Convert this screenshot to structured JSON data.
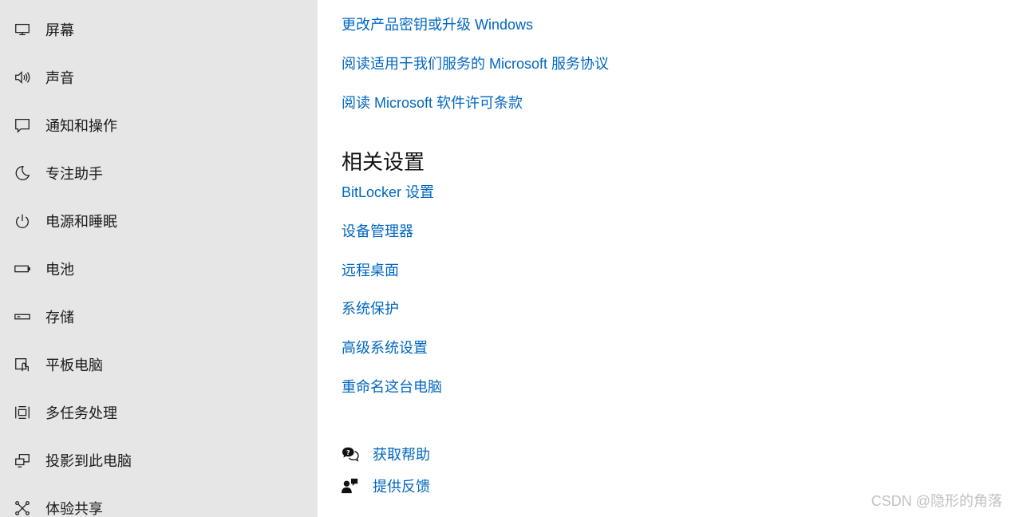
{
  "sidebar": {
    "items": [
      {
        "label": "屏幕",
        "icon": "monitor-icon"
      },
      {
        "label": "声音",
        "icon": "speaker-icon"
      },
      {
        "label": "通知和操作",
        "icon": "notification-icon"
      },
      {
        "label": "专注助手",
        "icon": "moon-icon"
      },
      {
        "label": "电源和睡眠",
        "icon": "power-icon"
      },
      {
        "label": "电池",
        "icon": "battery-icon"
      },
      {
        "label": "存储",
        "icon": "storage-icon"
      },
      {
        "label": "平板电脑",
        "icon": "tablet-icon"
      },
      {
        "label": "多任务处理",
        "icon": "multitask-icon"
      },
      {
        "label": "投影到此电脑",
        "icon": "project-icon"
      },
      {
        "label": "体验共享",
        "icon": "share-icon"
      }
    ]
  },
  "main": {
    "top_links": [
      "更改产品密钥或升级 Windows",
      "阅读适用于我们服务的 Microsoft 服务协议",
      "阅读 Microsoft 软件许可条款"
    ],
    "related_title": "相关设置",
    "related_links": [
      "BitLocker 设置",
      "设备管理器",
      "远程桌面",
      "系统保护",
      "高级系统设置",
      "重命名这台电脑"
    ],
    "help": {
      "get_help": "获取帮助",
      "feedback": "提供反馈"
    }
  },
  "watermark": "CSDN @隐形的角落",
  "colors": {
    "sidebar_bg": "#e6e6e6",
    "link": "#0067c0",
    "text": "#1a1a1a"
  }
}
